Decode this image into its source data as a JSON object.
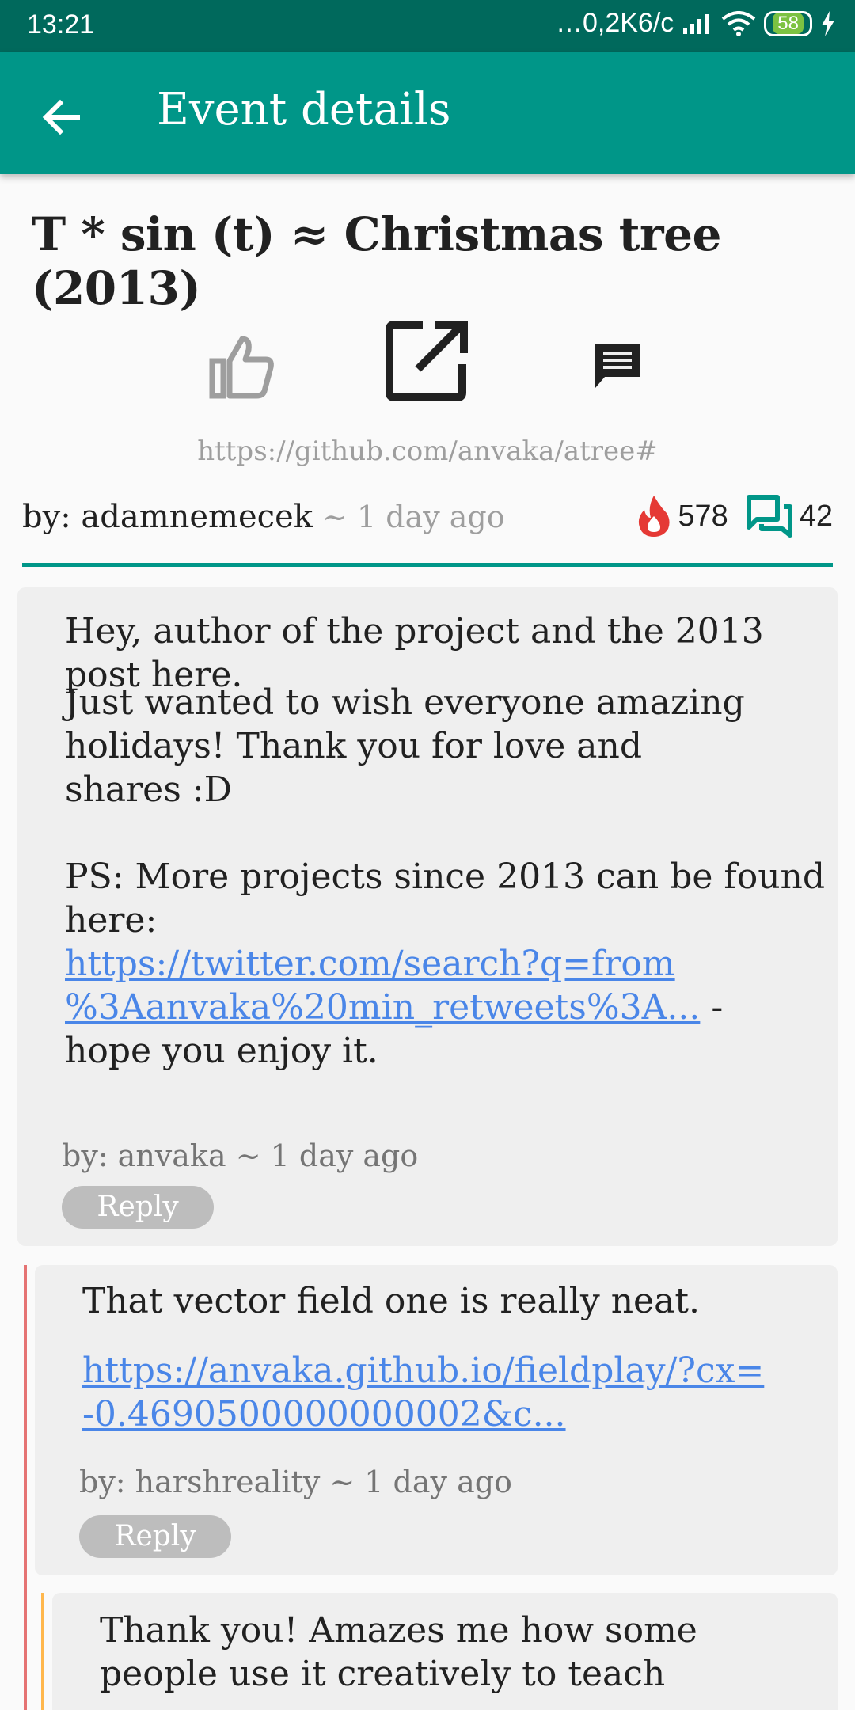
{
  "status_bar": {
    "time": "13:21",
    "network_speed": "…0,2K6/c",
    "battery_level": "58"
  },
  "app_bar": {
    "title": "Event details"
  },
  "post": {
    "title": "T * sin (t) ≈ Christmas tree (2013)",
    "url": "https://github.com/anvaka/atree#",
    "author_label": "by: adamnemecek",
    "time_ago": " ~ 1 day ago",
    "score": "578",
    "comments_count": "42"
  },
  "comments": [
    {
      "para1": "Hey, author of the project and the 2013 post here.",
      "para2_line1": "Just wanted to wish everyone amazing",
      "para2_line2": "holidays! Thank you for love and",
      "para2_line3": "shares :D",
      "para3_line1": "PS: More projects since 2013 can be found",
      "para3_line2": "here:",
      "link_line1": "https://twitter.com/search?q=from",
      "link_line2": "%3Aanvaka%20min_retweets%3A...",
      "after_link": " -",
      "last_line": "hope you enjoy it.",
      "meta": "by: anvaka ~ 1 day ago",
      "reply_label": "Reply"
    },
    {
      "text": "That vector field one is really neat.",
      "link_line1": "https://anvaka.github.io/fieldplay/?cx=",
      "link_line2": "-0.4690500000000002&c...",
      "meta": "by: harshreality ~ 1 day ago",
      "reply_label": "Reply"
    },
    {
      "line1": "Thank you! Amazes me how some",
      "line2": "people use it creatively to teach"
    }
  ],
  "colors": {
    "primary": "#009688",
    "primary_dark": "#00695c",
    "link": "#4a86e8",
    "fire": "#e53935",
    "thread_level1": "#e57373",
    "thread_level2": "#ffb74d"
  },
  "icons": [
    "back-arrow-icon",
    "thumb-up-icon",
    "open-in-new-icon",
    "comment-icon",
    "fire-icon",
    "forum-icon",
    "wifi-icon",
    "signal-icon",
    "charging-icon"
  ]
}
